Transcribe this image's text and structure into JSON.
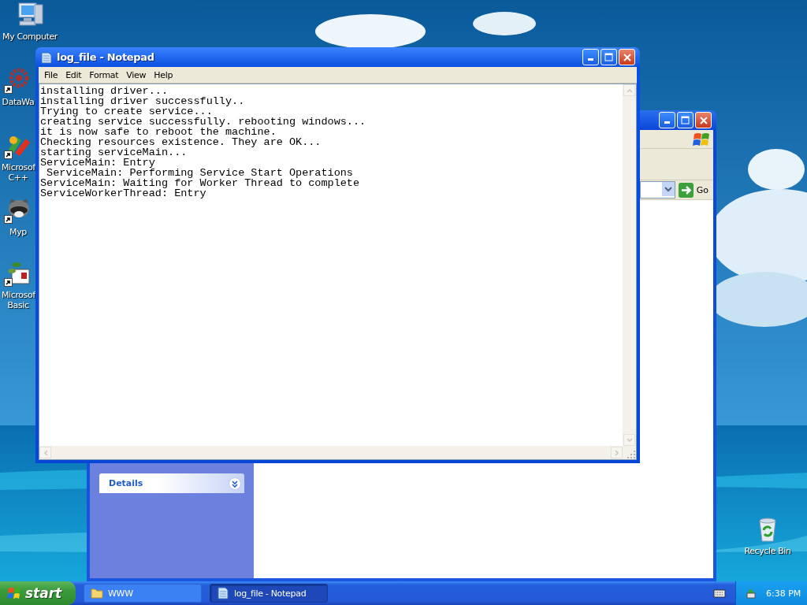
{
  "desktop_icons": [
    {
      "label": "My Computer",
      "kind": "computer",
      "shortcut": false
    },
    {
      "label": "DataWa",
      "kind": "gear",
      "shortcut": true
    },
    {
      "label": "Microsof C++",
      "kind": "studio",
      "shortcut": true
    },
    {
      "label": "Myp",
      "kind": "raccoon",
      "shortcut": true
    },
    {
      "label": "Microsof Basic",
      "kind": "basic",
      "shortcut": true
    },
    {
      "label": "Recycle Bin",
      "kind": "recycle",
      "shortcut": false
    }
  ],
  "explorer_window": {
    "go_button": "Go",
    "details_panel": {
      "title": "Details",
      "expanded": false
    }
  },
  "notepad_window": {
    "title": "log_file - Notepad",
    "menu": [
      "File",
      "Edit",
      "Format",
      "View",
      "Help"
    ],
    "lines": [
      "installing driver...",
      "installing driver successfully..",
      "Trying to create service...",
      "creating service successfully. rebooting windows...",
      "it is now safe to reboot the machine.",
      "Checking resources existence. They are OK...",
      "starting serviceMain...",
      "ServiceMain: Entry",
      " ServiceMain: Performing Service Start Operations",
      "ServiceMain: Waiting for Worker Thread to complete",
      "ServiceWorkerThread: Entry"
    ]
  },
  "taskbar": {
    "start": "start",
    "tasks": [
      {
        "label": "WWW",
        "kind": "folder",
        "selected": false
      },
      {
        "label": "log_file - Notepad",
        "kind": "notepad",
        "selected": true
      }
    ],
    "clock": "6:38 PM"
  }
}
